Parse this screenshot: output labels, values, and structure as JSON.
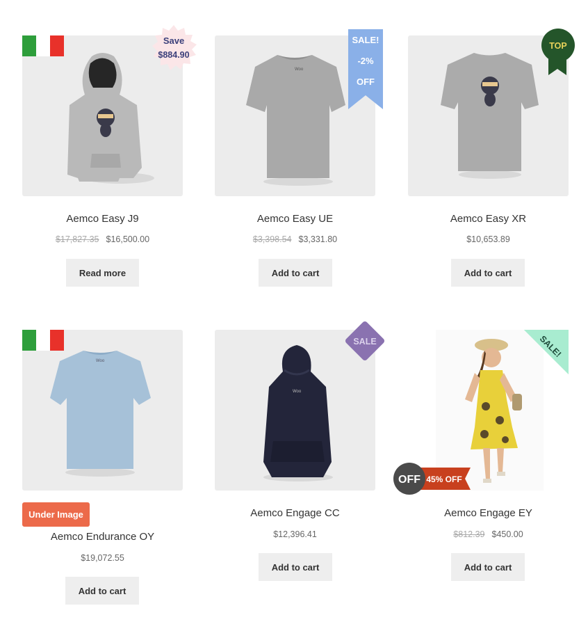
{
  "products": [
    {
      "title": "Aemco Easy J9",
      "old_price": "$17,827.35",
      "price": "$16,500.00",
      "button": "Read more",
      "badge": {
        "type": "starburst",
        "line1": "Save",
        "line2": "$884.90"
      },
      "flag": true
    },
    {
      "title": "Aemco Easy UE",
      "old_price": "$3,398.54",
      "price": "$3,331.80",
      "button": "Add to cart",
      "badge": {
        "type": "ribbon",
        "line1": "SALE!",
        "line2": "-2%",
        "line3": "OFF"
      }
    },
    {
      "title": "Aemco Easy XR",
      "old_price": "",
      "price": "$10,653.89",
      "button": "Add to cart",
      "badge": {
        "type": "rosette",
        "text": "TOP"
      }
    },
    {
      "title": "Aemco Endurance OY",
      "old_price": "",
      "price": "$19,072.55",
      "button": "Add to cart",
      "badge": {
        "type": "label",
        "text": "Under Image"
      },
      "flag": true
    },
    {
      "title": "Aemco Engage CC",
      "old_price": "",
      "price": "$12,396.41",
      "button": "Add to cart",
      "badge": {
        "type": "diamond",
        "text": "SALE"
      }
    },
    {
      "title": "Aemco Engage EY",
      "old_price": "$812.39",
      "price": "$450.00",
      "button": "Add to cart",
      "badge": {
        "type": "corner",
        "text": "SALE!"
      },
      "badge2": {
        "type": "off-tag",
        "circle": "OFF",
        "text": "45% OFF"
      }
    }
  ],
  "colors": {
    "flag_green": "#2e9e3b",
    "flag_white": "#ffffff",
    "flag_red": "#e8312a",
    "ribbon": "#8ab0e8",
    "rosette": "#24552a",
    "rosette_text": "#e8d25a",
    "diamond": "#8a72b0",
    "corner": "#a8ecd0",
    "label": "#ec6a4a",
    "off_tag": "#c8401e"
  }
}
